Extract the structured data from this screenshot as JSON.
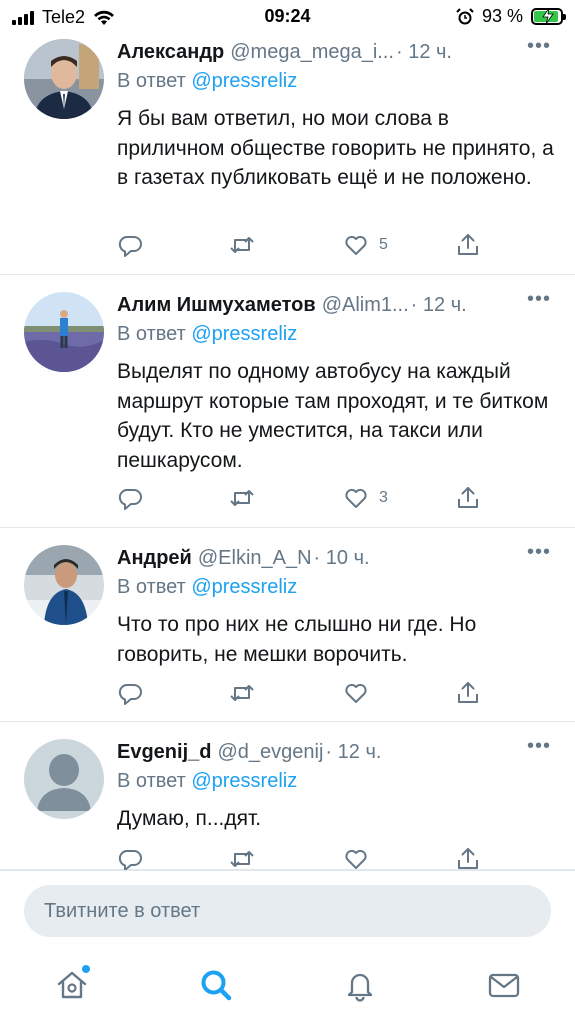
{
  "status_bar": {
    "carrier": "Tele2",
    "time": "09:24",
    "battery_percent": "93 %",
    "battery_level": 0.93
  },
  "tweets": [
    {
      "name": "Александр",
      "handle": "@mega_mega_i...",
      "time": "· 12 ч.",
      "reply_prefix": "В ответ",
      "reply_to": "@pressreliz",
      "text": "Я бы вам ответил, но мои слова в приличном обществе говорить не принято, а в газетах публиковать ещё и не положено.",
      "likes": "5"
    },
    {
      "name": "Алим Ишмухаметов",
      "handle": "@Alim1...",
      "time": "· 12 ч.",
      "reply_prefix": "В ответ",
      "reply_to": "@pressreliz",
      "text": "Выделят по одному автобусу на каждый маршрут которые там проходят, и те битком  будут. Кто не уместится, на такси или пешкарусом.",
      "likes": "3"
    },
    {
      "name": "Андрей",
      "handle": "@Elkin_A_N",
      "time": "· 10 ч.",
      "reply_prefix": "В ответ",
      "reply_to": "@pressreliz",
      "text": "Что то про них не слышно ни где. Но говорить, не мешки ворочить.",
      "likes": ""
    },
    {
      "name": "Evgenij_d",
      "handle": "@d_evgenij",
      "time": "· 12 ч.",
      "reply_prefix": "В ответ",
      "reply_to": "@pressreliz",
      "text": "Думаю, п...дят.",
      "likes": ""
    }
  ],
  "compose": {
    "placeholder": "Твитните в ответ"
  },
  "icons": {
    "more": "more-icon",
    "reply": "reply-icon",
    "retweet": "retweet-icon",
    "like": "like-icon",
    "share": "share-icon",
    "home": "home-icon",
    "search": "search-icon",
    "notifications": "bell-icon",
    "messages": "mail-icon"
  },
  "colors": {
    "accent": "#1da1f2",
    "secondary_text": "#657786",
    "battery_fill": "#33c748"
  }
}
